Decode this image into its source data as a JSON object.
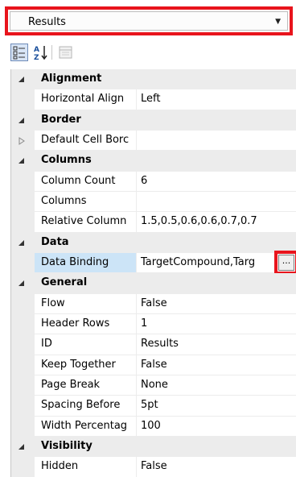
{
  "object_selector": {
    "value": "Results"
  },
  "toolbar": {
    "categorized_icon": "categorized-icon",
    "alphabetical_icon": "sort-az-icon",
    "property_pages_icon": "property-pages-icon"
  },
  "grid": {
    "categories": [
      {
        "name": "Alignment",
        "expanded": true,
        "props": [
          {
            "name": "Horizontal Align",
            "value": "Left"
          }
        ]
      },
      {
        "name": "Border",
        "expanded": true,
        "props": [
          {
            "name": "Default Cell Borc",
            "value": "",
            "expandable": true
          }
        ]
      },
      {
        "name": "Columns",
        "expanded": true,
        "props": [
          {
            "name": "Column Count",
            "value": "6"
          },
          {
            "name": "Columns",
            "value": ""
          },
          {
            "name": "Relative Column",
            "value": "1.5,0.5,0.6,0.6,0.7,0.7"
          }
        ]
      },
      {
        "name": "Data",
        "expanded": true,
        "props": [
          {
            "name": "Data Binding",
            "value": "TargetCompound,Targ",
            "selected": true,
            "ellipsis": "..."
          }
        ]
      },
      {
        "name": "General",
        "expanded": true,
        "props": [
          {
            "name": "Flow",
            "value": "False"
          },
          {
            "name": "Header Rows",
            "value": "1"
          },
          {
            "name": "ID",
            "value": "Results"
          },
          {
            "name": "Keep Together",
            "value": "False"
          },
          {
            "name": "Page Break",
            "value": "None"
          },
          {
            "name": "Spacing Before",
            "value": "5pt"
          },
          {
            "name": "Width Percentag",
            "value": "100"
          }
        ]
      },
      {
        "name": "Visibility",
        "expanded": true,
        "props": [
          {
            "name": "Hidden",
            "value": "False"
          }
        ]
      }
    ]
  },
  "colors": {
    "highlight_border": "#e8141c",
    "selection": "#cce4f7",
    "category_bg": "#ececec"
  }
}
